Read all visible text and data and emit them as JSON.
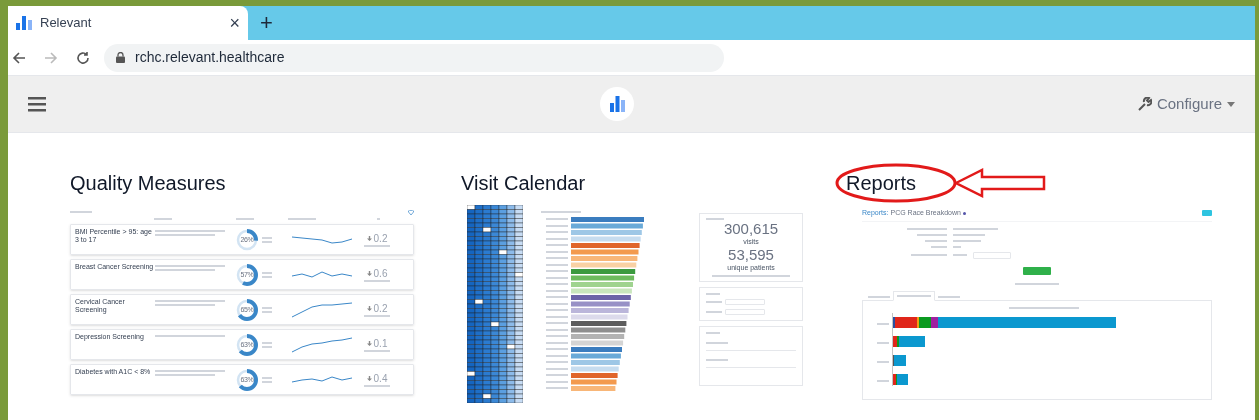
{
  "browser": {
    "tab_title": "Relevant",
    "tab_close": "×",
    "new_tab": "+",
    "url": "rchc.relevant.healthcare"
  },
  "header": {
    "configure": "Configure"
  },
  "sections": [
    {
      "kind": "quality",
      "title": "Quality Measures",
      "preview": {
        "rows": [
          {
            "name": "BMI Percentile > 95: age 3 to 17",
            "percent": "26%",
            "level": 0.26,
            "delta": "0.2"
          },
          {
            "name": "Breast Cancer Screening",
            "percent": "57%",
            "level": 0.57,
            "delta": "0.6"
          },
          {
            "name": "Cervical Cancer Screening",
            "percent": "65%",
            "level": 0.65,
            "delta": "0.2"
          },
          {
            "name": "Depression Screening",
            "percent": "63%",
            "level": 0.63,
            "delta": "0.1"
          },
          {
            "name": "Diabetes with A1C < 8%",
            "percent": "63%",
            "level": 0.63,
            "delta": "0.4"
          }
        ]
      }
    },
    {
      "kind": "calendar",
      "title": "Visit Calendar",
      "preview": {
        "visits": "300,615",
        "visits_label": "visits",
        "patients": "53,595",
        "patients_label": "unique patients"
      }
    },
    {
      "kind": "reports",
      "title": "Reports",
      "preview": {
        "crumb": "Reports:",
        "report_title": "PCG Race Breakdown"
      }
    }
  ]
}
